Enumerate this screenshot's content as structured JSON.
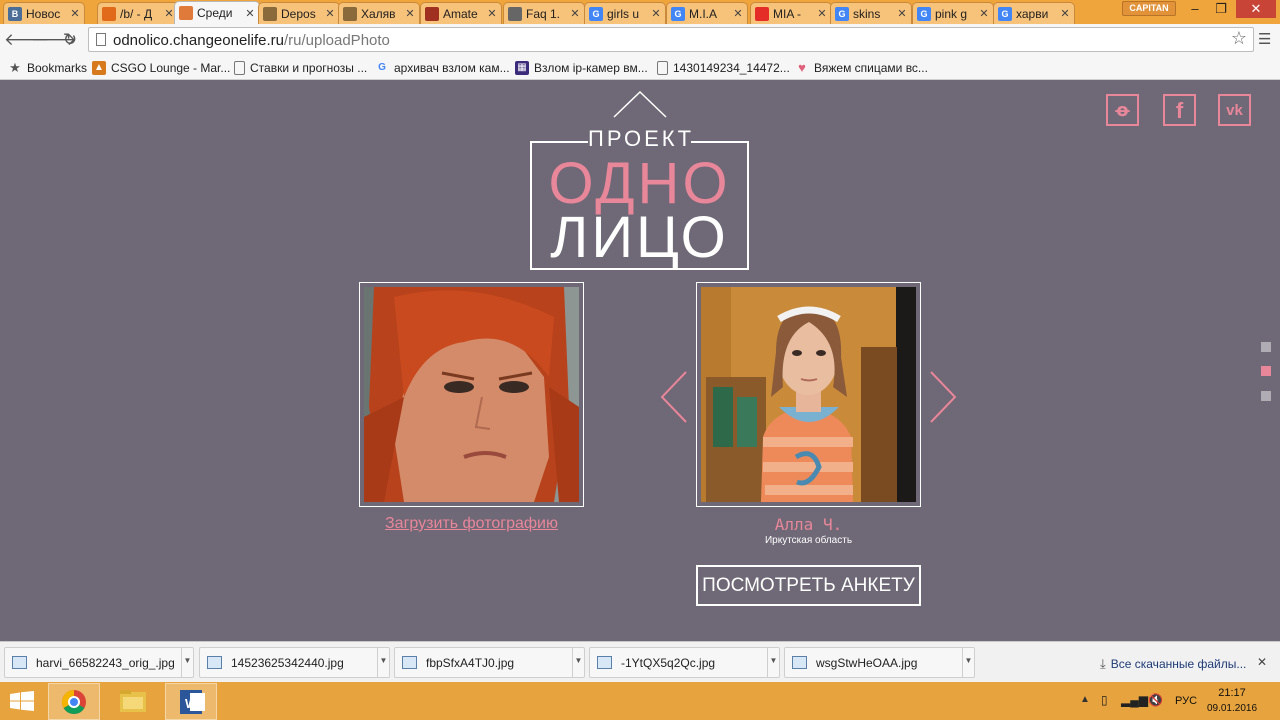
{
  "tabs": [
    {
      "title": "Новос",
      "favicon": "vk-icon",
      "color": "#4a6e98"
    },
    {
      "title": "/b/ - Д",
      "favicon": "bolt-icon",
      "color": "#e06a1a"
    },
    {
      "title": "Среди",
      "favicon": "onelife-icon",
      "color": "#e07a3a"
    },
    {
      "title": "Depos",
      "favicon": "card-icon",
      "color": "#8a6a3a"
    },
    {
      "title": "Халяв",
      "favicon": "star-outline-icon",
      "color": "#8a6a3a"
    },
    {
      "title": "Amate",
      "favicon": "amate-icon",
      "color": "#a03020"
    },
    {
      "title": "Faq 1.",
      "favicon": "grid-icon",
      "color": "#666666"
    },
    {
      "title": "girls u",
      "favicon": "google-icon",
      "color": "#4285f4"
    },
    {
      "title": "M.I.A",
      "favicon": "google-icon",
      "color": "#4285f4"
    },
    {
      "title": "MIA -",
      "favicon": "youtube-icon",
      "color": "#e52d27"
    },
    {
      "title": "skins",
      "favicon": "google-icon",
      "color": "#4285f4"
    },
    {
      "title": "pink g",
      "favicon": "google-icon",
      "color": "#4285f4"
    },
    {
      "title": "харви",
      "favicon": "google-icon",
      "color": "#4285f4"
    }
  ],
  "user_badge": "CAPITAN",
  "url": {
    "host": "odnolico.changeonelife.ru",
    "path": "/ru/uploadPhoto"
  },
  "bookmarks": [
    {
      "label": "Bookmarks",
      "icon": "star-icon"
    },
    {
      "label": "CSGO Lounge - Mar...",
      "icon": "csgo-icon"
    },
    {
      "label": "Ставки и прогнозы ...",
      "icon": "page-icon"
    },
    {
      "label": "архивач взлом кам...",
      "icon": "google-icon"
    },
    {
      "label": "Взлом ip-камер вм...",
      "icon": "app-icon"
    },
    {
      "label": "1430149234_14472...",
      "icon": "page-icon"
    },
    {
      "label": "Вяжем спицами вс...",
      "icon": "heart-icon"
    }
  ],
  "logo": {
    "top": "ПРОЕКТ",
    "line1": "ОДНО",
    "line2": "ЛИЦО"
  },
  "social": {
    "ok": "ok",
    "fb": "f",
    "vk": "vk"
  },
  "upload_link": "Загрузить фотографию",
  "person": {
    "name": "Алла Ч.",
    "region": "Иркутская область"
  },
  "view_button": "ПОСМОТРЕТЬ АНКЕТУ",
  "pager": {
    "count": 3,
    "active": 2
  },
  "downloads": [
    {
      "name": "harvi_66582243_orig_.jpg"
    },
    {
      "name": "14523625342440.jpg"
    },
    {
      "name": "fbpSfxA4TJ0.jpg"
    },
    {
      "name": "-1YtQX5q2Qc.jpg"
    },
    {
      "name": "wsgStwHeOAA.jpg"
    }
  ],
  "downloads_all": "Все скачанные файлы...",
  "taskbar": {
    "lang": "РУС",
    "time": "21:17",
    "date": "09.01.2016"
  },
  "colors": {
    "page_bg": "#6f6876",
    "accent": "#e8869a",
    "taskbar": "#e7a33d"
  }
}
